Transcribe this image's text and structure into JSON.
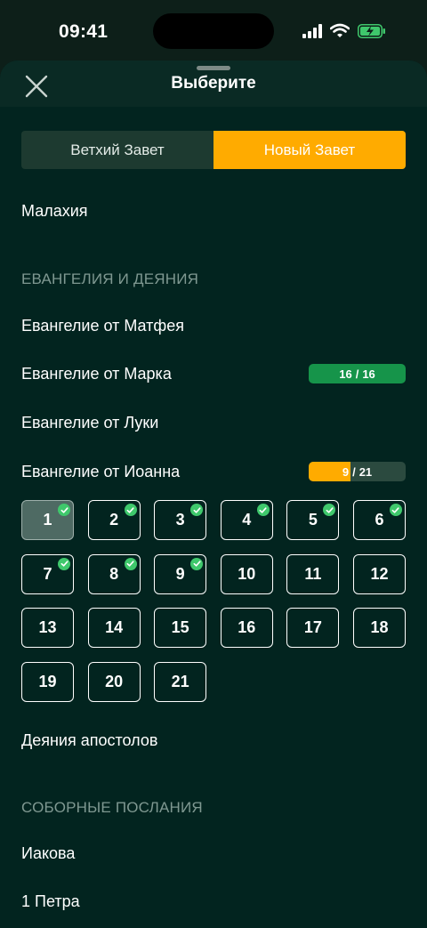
{
  "status_bar": {
    "time": "09:41"
  },
  "header": {
    "title": "Выберите"
  },
  "testament_tabs": [
    {
      "label": "Ветхий Завет",
      "active": false
    },
    {
      "label": "Новый Завет",
      "active": true
    }
  ],
  "books_before": [
    "Малахия"
  ],
  "sections": [
    {
      "title": "ЕВАНГЕЛИЯ И ДЕЯНИЯ"
    },
    {
      "title": "СОБОРНЫЕ ПОСЛАНИЯ"
    }
  ],
  "books": [
    {
      "name": "Евангелие от Матфея"
    },
    {
      "name": "Евангелие от Марка",
      "progress": {
        "read": "16",
        "total": "16",
        "fraction": 1.0
      }
    },
    {
      "name": "Евангелие от Луки"
    },
    {
      "name": "Евангелие от Иоанна",
      "progress": {
        "read": "9",
        "total": "21",
        "fraction": 0.43
      }
    },
    {
      "name": "Деяния апостолов"
    },
    {
      "name": "Иакова"
    },
    {
      "name": "1 Петра"
    }
  ],
  "chapters": [
    {
      "n": "1",
      "read": true,
      "current": true
    },
    {
      "n": "2",
      "read": true
    },
    {
      "n": "3",
      "read": true
    },
    {
      "n": "4",
      "read": true
    },
    {
      "n": "5",
      "read": true
    },
    {
      "n": "6",
      "read": true
    },
    {
      "n": "7",
      "read": true
    },
    {
      "n": "8",
      "read": true
    },
    {
      "n": "9",
      "read": true
    },
    {
      "n": "10",
      "read": false
    },
    {
      "n": "11",
      "read": false
    },
    {
      "n": "12",
      "read": false
    },
    {
      "n": "13",
      "read": false
    },
    {
      "n": "14",
      "read": false
    },
    {
      "n": "15",
      "read": false
    },
    {
      "n": "16",
      "read": false
    },
    {
      "n": "17",
      "read": false
    },
    {
      "n": "18",
      "read": false
    },
    {
      "n": "19",
      "read": false
    },
    {
      "n": "20",
      "read": false
    },
    {
      "n": "21",
      "read": false
    }
  ],
  "progress_separator": "/",
  "colors": {
    "accent": "#ffab00",
    "complete": "#16944a",
    "check": "#3fc86c",
    "background": "#02241f"
  }
}
